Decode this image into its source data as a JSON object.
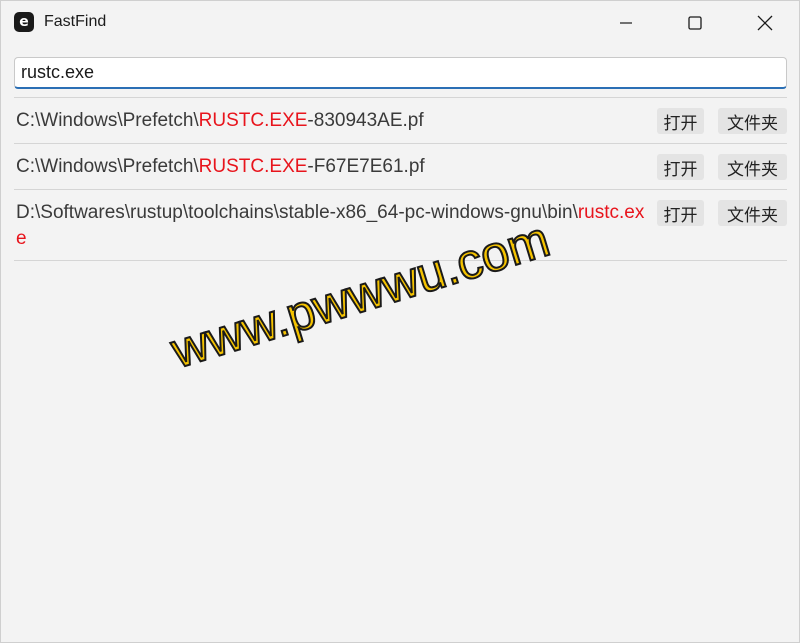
{
  "window": {
    "title": "FastFind",
    "icon_letter": "e"
  },
  "search": {
    "value": "rustc.exe"
  },
  "results": [
    {
      "prefix": "C:\\Windows\\Prefetch\\",
      "match": "RUSTC.EXE",
      "suffix": "-830943AE.pf",
      "open_label": "打开",
      "folder_label": "文件夹"
    },
    {
      "prefix": "C:\\Windows\\Prefetch\\",
      "match": "RUSTC.EXE",
      "suffix": "-F67E7E61.pf",
      "open_label": "打开",
      "folder_label": "文件夹"
    },
    {
      "prefix": "D:\\Softwares\\rustup\\toolchains\\stable-x86_64-pc-windows-gnu\\bin\\",
      "match": "rustc.exe",
      "suffix": "",
      "open_label": "打开",
      "folder_label": "文件夹"
    }
  ],
  "watermark": {
    "text": "www.pwwwu.com"
  },
  "colors": {
    "highlight": "#e8141c",
    "accent": "#2b6fb5",
    "watermark_fill": "#f5c300"
  },
  "icons": {
    "minimize": "minimize-icon",
    "maximize": "maximize-icon",
    "close": "close-icon"
  }
}
